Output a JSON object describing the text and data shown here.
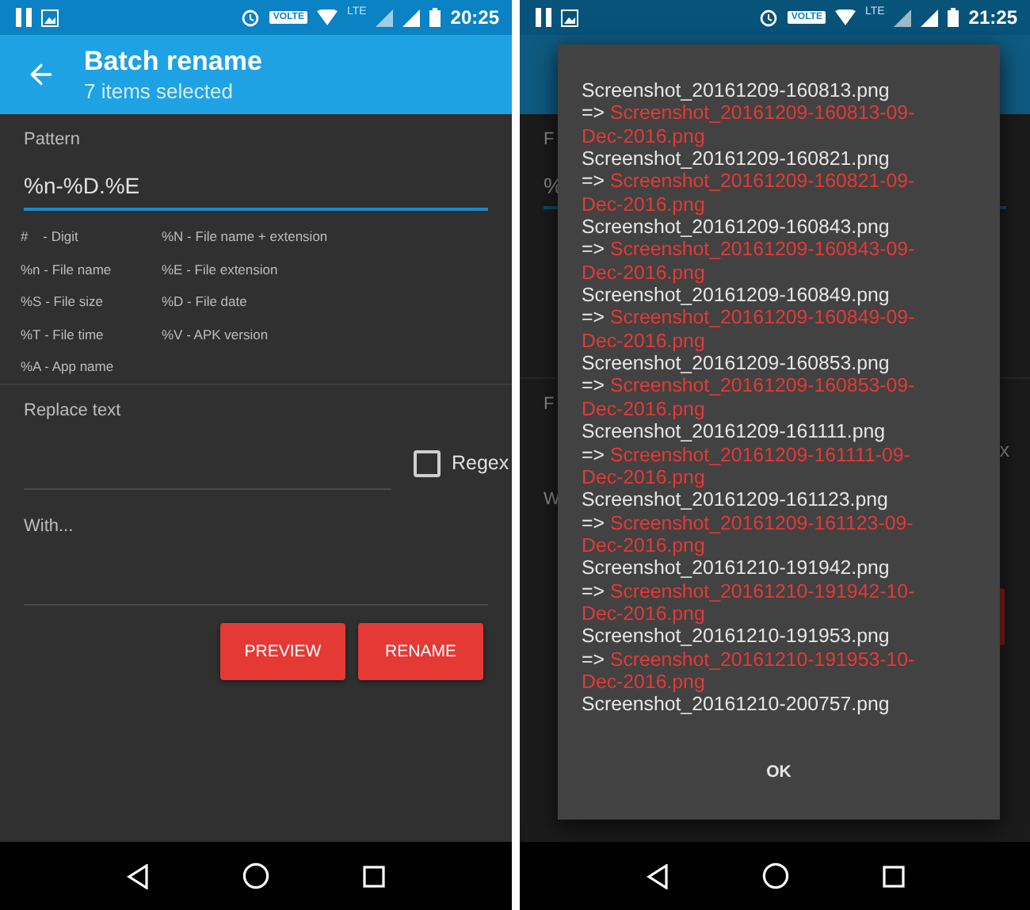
{
  "left_screen": {
    "status_bar": {
      "badge": "VOLTE",
      "network": "LTE",
      "time": "20:25"
    },
    "app_bar": {
      "title": "Batch rename",
      "subtitle": "7 items selected"
    },
    "pattern": {
      "label": "Pattern",
      "value": "%n-%D.%E"
    },
    "legend": [
      "#    - Digit",
      "%N - File name + extension",
      "%n - File name",
      "%E - File extension",
      "%S - File size",
      "%D - File date",
      "%T - File time",
      "%V - APK version",
      "%A - App name"
    ],
    "replace": {
      "placeholder": "Replace text"
    },
    "regex": {
      "label": "Regex",
      "checked": false
    },
    "with": {
      "placeholder": "With..."
    },
    "buttons": [
      "PREVIEW",
      "RENAME"
    ]
  },
  "right_screen": {
    "status_bar": {
      "badge": "VOLTE",
      "network": "LTE",
      "time": "21:25"
    },
    "peek": {
      "pattern_label": "F",
      "pattern_value": "%",
      "replace": "F",
      "regex": "x",
      "with": "W"
    },
    "dialog": {
      "items": [
        {
          "original": "Screenshot_20161209-160813.png",
          "prefix": "=>",
          "renamed": "Screenshot_20161209-160813-09-Dec-2016.png"
        },
        {
          "original": "Screenshot_20161209-160821.png",
          "prefix": "=>",
          "renamed": "Screenshot_20161209-160821-09-Dec-2016.png"
        },
        {
          "original": "Screenshot_20161209-160843.png",
          "prefix": "=>",
          "renamed": "Screenshot_20161209-160843-09-Dec-2016.png"
        },
        {
          "original": "Screenshot_20161209-160849.png",
          "prefix": "=>",
          "renamed": "Screenshot_20161209-160849-09-Dec-2016.png"
        },
        {
          "original": "Screenshot_20161209-160853.png",
          "prefix": "=>",
          "renamed": "Screenshot_20161209-160853-09-Dec-2016.png"
        },
        {
          "original": "Screenshot_20161209-161111.png",
          "prefix": "=>",
          "renamed": "Screenshot_20161209-161111-09-Dec-2016.png"
        },
        {
          "original": "Screenshot_20161209-161123.png",
          "prefix": "=>",
          "renamed": "Screenshot_20161209-161123-09-Dec-2016.png"
        },
        {
          "original": "Screenshot_20161210-191942.png",
          "prefix": "=>",
          "renamed": "Screenshot_20161210-191942-10-Dec-2016.png"
        },
        {
          "original": "Screenshot_20161210-191953.png",
          "prefix": "=>",
          "renamed": "Screenshot_20161210-191953-10-Dec-2016.png"
        },
        {
          "original": "Screenshot_20161210-200757.png"
        }
      ],
      "ok": "OK"
    }
  }
}
